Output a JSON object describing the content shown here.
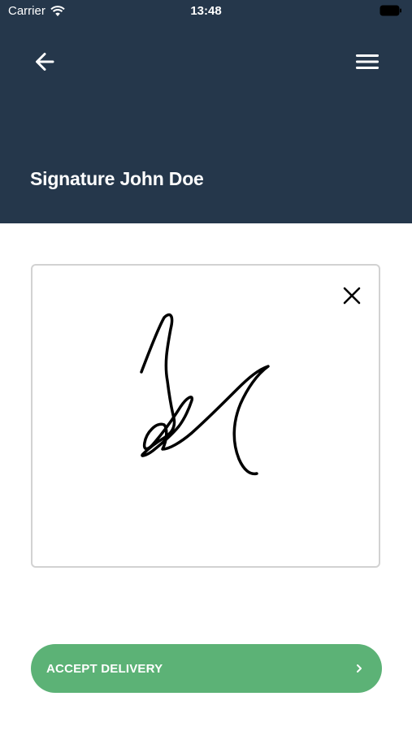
{
  "status_bar": {
    "carrier": "Carrier",
    "time": "13:48"
  },
  "header": {
    "title": "Signature John Doe",
    "background_color": "#25374b"
  },
  "icons": {
    "back": "arrow-left-icon",
    "menu": "hamburger-menu-icon",
    "clear": "close-icon",
    "accept": "chevron-right-icon"
  },
  "actions": {
    "accept_label": "ACCEPT DELIVERY",
    "accept_color": "#5cb276"
  }
}
